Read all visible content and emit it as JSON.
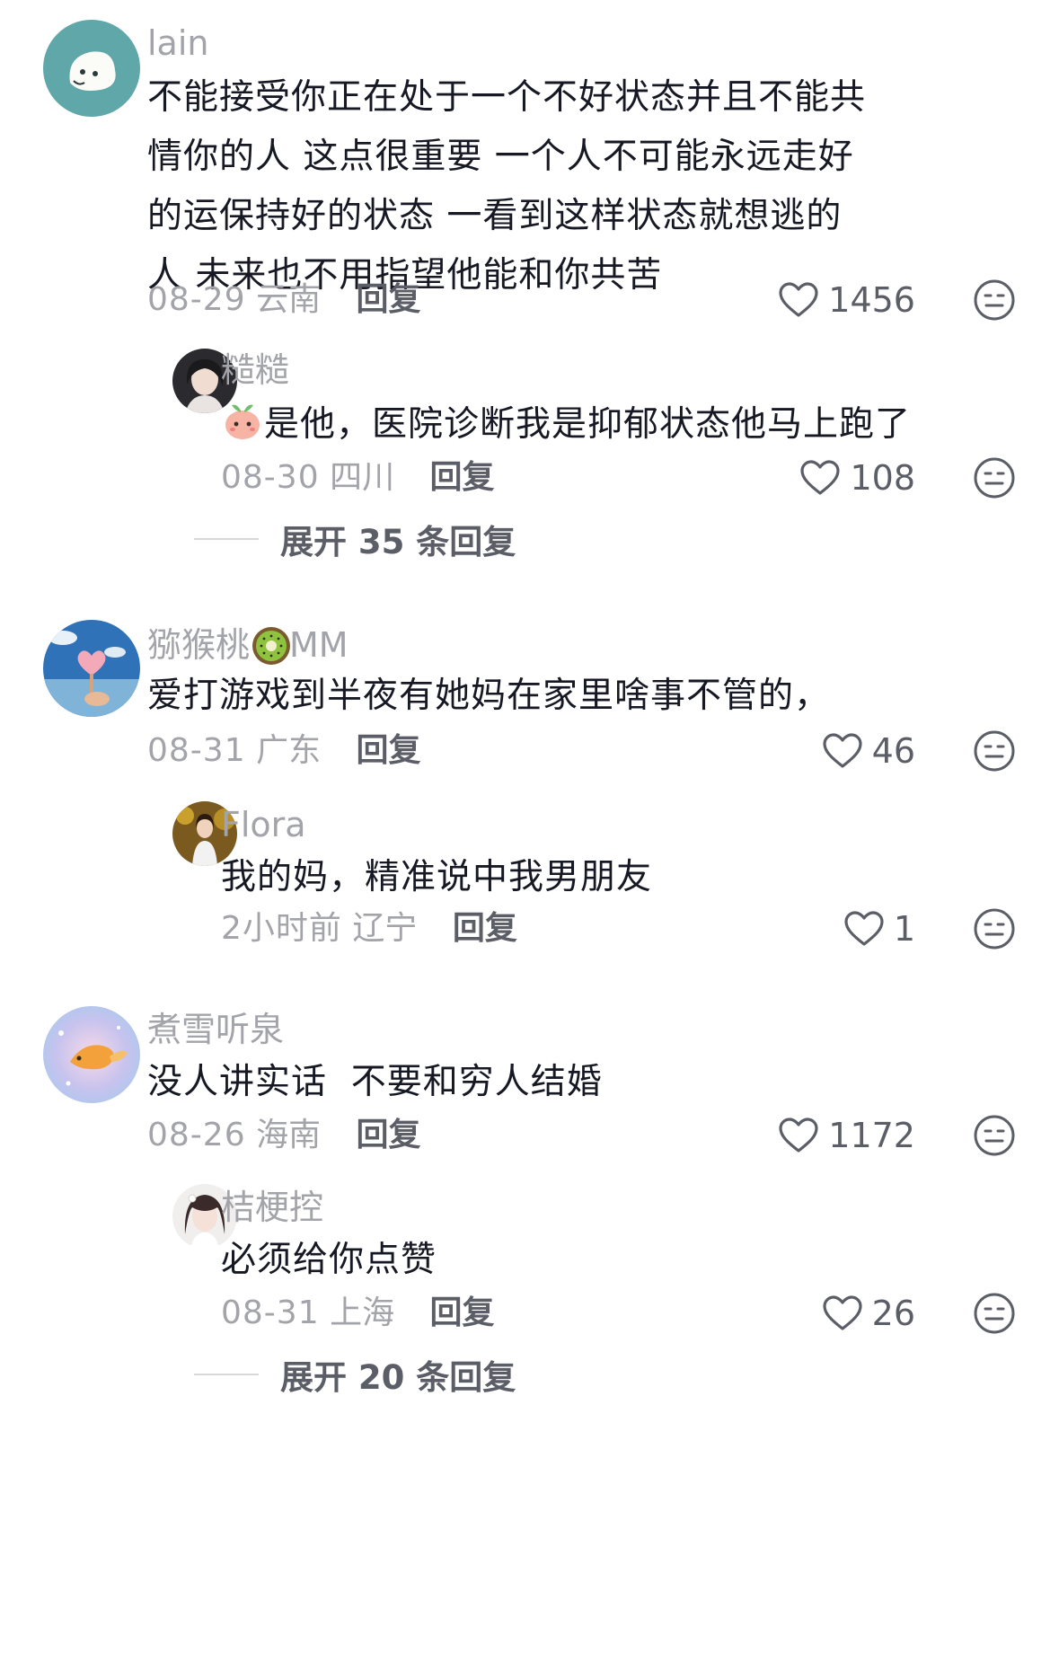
{
  "comments": [
    {
      "username": "lain",
      "text": "不能接受你正在处于一个不好状态并且不能共情你的人 这点很重要 一个人不可能永远走好的运保持好的状态  一看到这样状态就想逃的人 未来也不用指望他能和你共苦",
      "date": "08-29",
      "location": "云南",
      "reply_label": "回复",
      "likes": "1456",
      "avatar": "blue-cartoon-avatar",
      "replies": [
        {
          "username": "糙糙",
          "emoji": "peach-face-emoji",
          "text": "是他，医院诊断我是抑郁状态他马上跑了",
          "date": "08-30",
          "location": "四川",
          "reply_label": "回复",
          "likes": "108"
        }
      ],
      "expand_label": "展开 35 条回复"
    },
    {
      "username": "猕猴桃",
      "username_emoji": "kiwi-emoji",
      "username_suffix": "MM",
      "text": "爱打游戏到半夜有她妈在家里啥事不管的，",
      "date": "08-31",
      "location": "广东",
      "reply_label": "回复",
      "likes": "46",
      "replies": [
        {
          "username": "Flora",
          "text": "我的妈，精准说中我男朋友",
          "date": "2小时前",
          "location": "辽宁",
          "reply_label": "回复",
          "likes": "1"
        }
      ]
    },
    {
      "username": "煮雪听泉",
      "text": "没人讲实话  不要和穷人结婚",
      "date": "08-26",
      "location": "海南",
      "reply_label": "回复",
      "likes": "1172",
      "replies": [
        {
          "username": "桔梗控",
          "text": "必须给你点赞",
          "date": "08-31",
          "location": "上海",
          "reply_label": "回复",
          "likes": "26"
        }
      ],
      "expand_label": "展开 20 条回复"
    }
  ],
  "colors": {
    "primary_text": "#161823",
    "secondary_text": "#a3a4a9",
    "action_text": "#5c5e67"
  }
}
